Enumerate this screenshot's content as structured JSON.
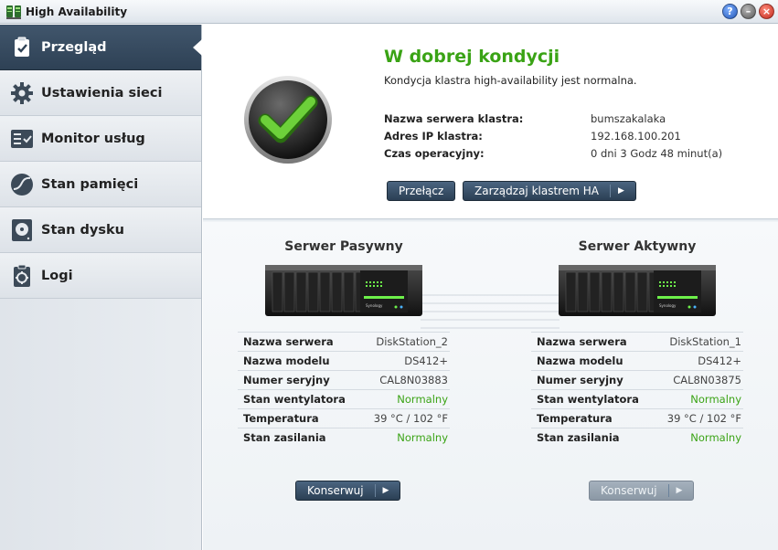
{
  "window": {
    "title": "High Availability",
    "help_label": "?",
    "minimize_label": "–",
    "close_label": "×"
  },
  "sidebar": {
    "items": [
      {
        "label": "Przegląd",
        "icon": "clipboard-check-icon",
        "active": true
      },
      {
        "label": "Ustawienia sieci",
        "icon": "gear-icon",
        "active": false
      },
      {
        "label": "Monitor usług",
        "icon": "service-monitor-icon",
        "active": false
      },
      {
        "label": "Stan pamięci",
        "icon": "storage-gauge-icon",
        "active": false
      },
      {
        "label": "Stan dysku",
        "icon": "disk-icon",
        "active": false
      },
      {
        "label": "Logi",
        "icon": "log-icon",
        "active": false
      }
    ]
  },
  "status": {
    "title": "W dobrej kondycji",
    "description": "Kondycja klastra high-availability jest normalna.",
    "rows": [
      {
        "label": "Nazwa serwera klastra:",
        "value": "bumszakalaka"
      },
      {
        "label": "Adres IP klastra:",
        "value": "192.168.100.201"
      },
      {
        "label": "Czas operacyjny:",
        "value": "0 dni 3 Godz 48 minut(a)"
      }
    ],
    "switch_button": "Przełącz",
    "manage_button": "Zarządzaj klastrem HA",
    "status_color": "#3aa315"
  },
  "servers": {
    "passive": {
      "title": "Serwer Pasywny",
      "rows": [
        {
          "label": "Nazwa serwera",
          "value": "DiskStation_2"
        },
        {
          "label": "Nazwa modelu",
          "value": "DS412+"
        },
        {
          "label": "Numer seryjny",
          "value": "CAL8N03883"
        },
        {
          "label": "Stan wentylatora",
          "value": "Normalny"
        },
        {
          "label": "Temperatura",
          "value": "39 °C / 102 °F"
        },
        {
          "label": "Stan zasilania",
          "value": "Normalny"
        }
      ],
      "maintenance_button": "Konserwuj"
    },
    "active": {
      "title": "Serwer Aktywny",
      "rows": [
        {
          "label": "Nazwa serwera",
          "value": "DiskStation_1"
        },
        {
          "label": "Nazwa modelu",
          "value": "DS412+"
        },
        {
          "label": "Numer seryjny",
          "value": "CAL8N03875"
        },
        {
          "label": "Stan wentylatora",
          "value": "Normalny"
        },
        {
          "label": "Temperatura",
          "value": "39 °C / 102 °F"
        },
        {
          "label": "Stan zasilania",
          "value": "Normalny"
        }
      ],
      "maintenance_button": "Konserwuj"
    },
    "device_brand": "Synology"
  }
}
